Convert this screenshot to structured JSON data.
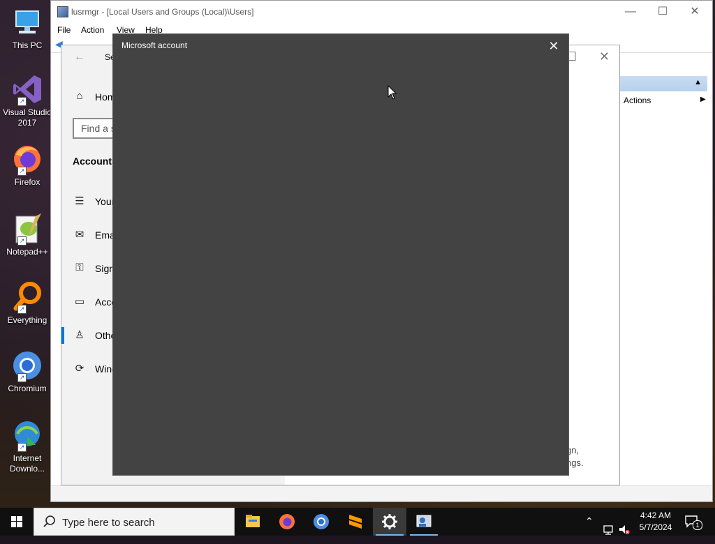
{
  "desktop": {
    "icons": [
      {
        "label": "This PC"
      },
      {
        "label": "Visual Studio 2017"
      },
      {
        "label": "Firefox"
      },
      {
        "label": "Notepad++"
      },
      {
        "label": "Everything"
      },
      {
        "label": "Chromium"
      },
      {
        "label": "Internet Downlo..."
      }
    ]
  },
  "mmc": {
    "title": "lusrmgr - [Local Users and Groups (Local)\\Users]",
    "menu": [
      "File",
      "Action",
      "View",
      "Help"
    ],
    "actions_label": "Actions"
  },
  "settings": {
    "title": "Se",
    "search_placeholder": "Find a s",
    "heading": "Accounts",
    "nav_items": [
      {
        "label": "Hom",
        "icon": "home-icon"
      },
      {
        "label": "Your",
        "icon": "person-card-icon"
      },
      {
        "label": "Ema",
        "icon": "mail-icon"
      },
      {
        "label": "Sign",
        "icon": "key-icon"
      },
      {
        "label": "Acce",
        "icon": "briefcase-icon"
      },
      {
        "label": "Othe",
        "icon": "add-person-icon"
      },
      {
        "label": "Wind",
        "icon": "sync-icon"
      }
    ],
    "selected_item": "Othe",
    "footer_line1": "gn,",
    "footer_line2": "ngs."
  },
  "dialog": {
    "title": "Microsoft account"
  },
  "taskbar": {
    "search_placeholder": "Type here to search",
    "apps": [
      "file-explorer-icon",
      "firefox-icon",
      "chromium-icon",
      "sublime-icon",
      "settings-icon",
      "lusrmgr-icon"
    ],
    "active_app": "settings-icon",
    "time": "4:42 AM",
    "date": "5/7/2024",
    "notification_count": "1"
  },
  "colors": {
    "dialog_bg": "#434343",
    "accent": "#0078d7",
    "taskbar_bg": "#101010"
  }
}
